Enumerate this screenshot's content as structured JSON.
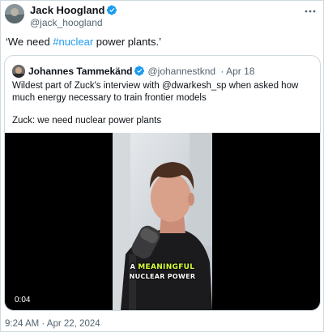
{
  "author": {
    "name": "Jack Hoogland",
    "handle": "@jack_hoogland",
    "verified": true
  },
  "tweet": {
    "text_before": "‘We need ",
    "hashtag": "#nuclear",
    "text_after": " power plants.’",
    "timestamp": "9:24 AM · Apr 22, 2024"
  },
  "quoted": {
    "name": "Johannes Tammekänd",
    "handle": "@johannestknd",
    "date": "· Apr 18",
    "paragraphs": [
      "Wildest part of Zuck's interview with @dwarkesh_sp when asked how much energy necessary to train frontier models",
      "Zuck: we need nuclear power plants"
    ],
    "video": {
      "duration": "0:04",
      "caption_prefix": "A ",
      "caption_highlight": "MEANINGFUL",
      "caption_line2": "NUCLEAR POWER"
    }
  },
  "colors": {
    "link": "#1d9bf0",
    "verified": "#1d9bf0",
    "text": "#0f1419",
    "muted": "#536471",
    "border": "#cfd9de"
  },
  "icons": {
    "more": "more-icon",
    "verified": "verified-badge-icon"
  }
}
